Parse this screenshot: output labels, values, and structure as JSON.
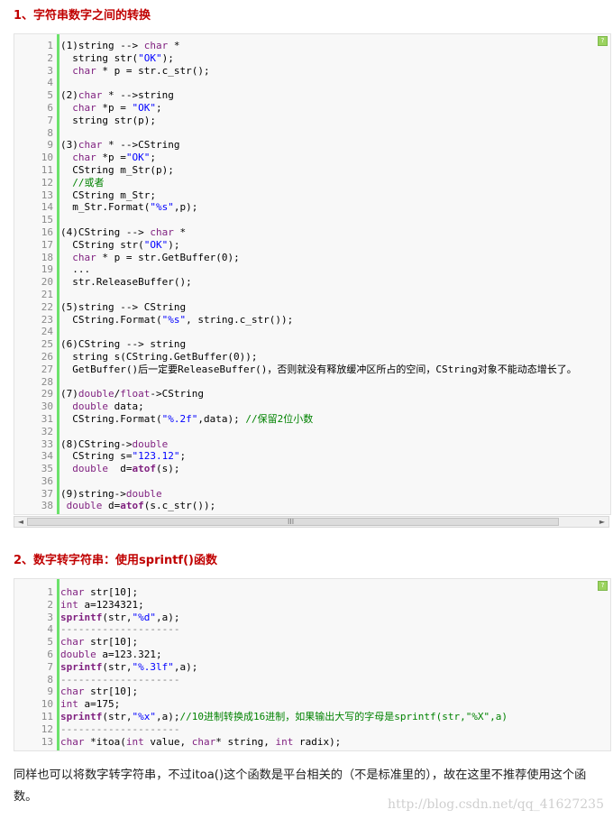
{
  "section1": {
    "title": "1、字符串数字之间的转换",
    "lines": [
      "(1)string --> char *",
      "  string str(\"OK\");",
      "  char * p = str.c_str();",
      "",
      "(2)char * -->string",
      "  char *p = \"OK\";",
      "  string str(p);",
      "",
      "(3)char * -->CString",
      "  char *p =\"OK\";",
      "  CString m_Str(p);",
      "  //或者",
      "  CString m_Str;",
      "  m_Str.Format(\"%s\",p);",
      "",
      "(4)CString --> char *",
      "  CString str(\"OK\");",
      "  char * p = str.GetBuffer(0);",
      "  ...",
      "  str.ReleaseBuffer();",
      "",
      "(5)string --> CString",
      "  CString.Format(\"%s\", string.c_str());",
      "",
      "(6)CString --> string",
      "  string s(CString.GetBuffer(0));",
      "  GetBuffer()后一定要ReleaseBuffer()，否则就没有释放缓冲区所占的空间，CString对象不能动态增长了。",
      "",
      "(7)double/float->CString",
      "  double data;",
      "  CString.Format(\"%.2f\",data); //保留2位小数",
      "",
      "(8)CString->double",
      "  CString s=\"123.12\";",
      "  double  d=atof(s);",
      "",
      "(9)string->double",
      " double d=atof(s.c_str());"
    ]
  },
  "section2": {
    "title": "2、数字转字符串：使用sprintf()函数",
    "lines": [
      "char str[10];",
      "int a=1234321;",
      "sprintf(str,\"%d\",a);",
      "--------------------",
      "char str[10];",
      "double a=123.321;",
      "sprintf(str,\"%.3lf\",a);",
      "--------------------",
      "char str[10];",
      "int a=175;",
      "sprintf(str,\"%x\",a);//10进制转换成16进制，如果输出大写的字母是sprintf(str,\"%X\",a)",
      "--------------------",
      "char *itoa(int value, char* string, int radix);"
    ]
  },
  "toolbar": {
    "icon": "?"
  },
  "scrollbar": {
    "left": "◄",
    "right": "►",
    "grip": "III"
  },
  "paragraph": "同样也可以将数字转字符串，不过itoa()这个函数是平台相关的（不是标准里的），故在这里不推荐使用这个函数。",
  "watermark": "http://blog.csdn.net/qq_41627235"
}
